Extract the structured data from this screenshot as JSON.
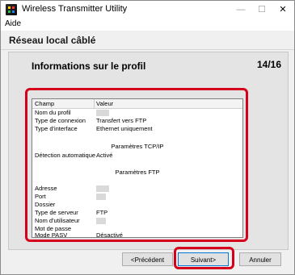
{
  "window": {
    "title": "Wireless Transmitter Utility",
    "min_symbol": "—",
    "max_symbol": "☐",
    "close_symbol": "✕"
  },
  "menu": {
    "items": [
      "Aide"
    ]
  },
  "section": {
    "title": "Réseau local câblé"
  },
  "panel": {
    "title": "Informations sur le profil",
    "page": "14/16"
  },
  "table": {
    "headers": [
      "Champ",
      "Valeur"
    ],
    "rows": [
      {
        "label": "Nom du profil",
        "value": "",
        "hidden": true
      },
      {
        "label": "Type de connexion",
        "value": "Transfert vers FTP"
      },
      {
        "label": "Type d'interface",
        "value": "Ethernet uniquement"
      },
      {
        "label": "",
        "value": ""
      },
      {
        "section": "Paramètres TCP/IP"
      },
      {
        "label": "Détection automatique",
        "value": "Activé"
      },
      {
        "label": "",
        "value": ""
      },
      {
        "section": "Paramètres FTP"
      },
      {
        "label": "",
        "value": ""
      },
      {
        "label": "Adresse",
        "value": "",
        "hidden": true
      },
      {
        "label": "Port",
        "value": "",
        "hidden": true
      },
      {
        "label": "Dossier",
        "value": ""
      },
      {
        "label": "Type de serveur",
        "value": "FTP"
      },
      {
        "label": "Nom d'utilisateur",
        "value": "",
        "hidden": true
      },
      {
        "label": "Mot de passe",
        "value": ""
      },
      {
        "label": "Mode PASV",
        "value": "Désactivé"
      }
    ]
  },
  "buttons": {
    "prev": "<Précédent",
    "next": "Suivant>",
    "cancel": "Annuler"
  },
  "colors": {
    "highlight": "#d6001c",
    "primary_border": "#0078d7"
  },
  "icons": {
    "app": "app-icon"
  }
}
